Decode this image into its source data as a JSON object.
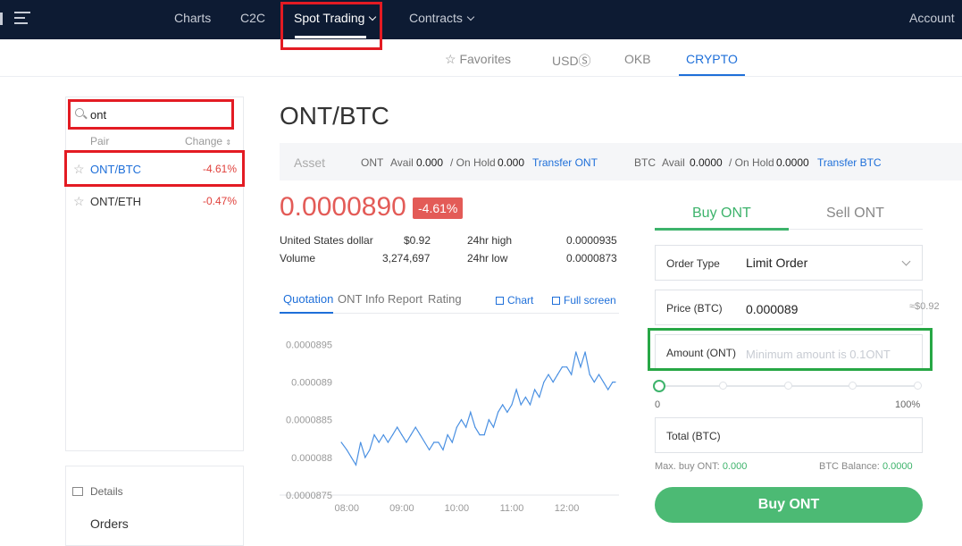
{
  "topnav": {
    "items": [
      {
        "label": "Charts"
      },
      {
        "label": "C2C"
      },
      {
        "label": "Spot Trading"
      },
      {
        "label": "Contracts"
      }
    ],
    "account": "Account"
  },
  "subnav": {
    "items": [
      {
        "label": "Favorites"
      },
      {
        "label": "USDⓈ"
      },
      {
        "label": "OKB"
      },
      {
        "label": "CRYPTO"
      }
    ]
  },
  "pairs_panel": {
    "search_value": "ont",
    "col_pair": "Pair",
    "col_change": "Change",
    "rows": [
      {
        "name": "ONT/BTC",
        "change": "-4.61%"
      },
      {
        "name": "ONT/ETH",
        "change": "-0.47%"
      }
    ],
    "details": "Details",
    "orders": "Orders"
  },
  "main": {
    "pair_title": "ONT/BTC",
    "asset_bar": {
      "label": "Asset",
      "ont": {
        "coin": "ONT",
        "avail_label": "Avail",
        "avail": "0.000",
        "hold_label": "/ On Hold",
        "hold": "0.000",
        "transfer": "Transfer ONT"
      },
      "btc": {
        "coin": "BTC",
        "avail_label": "Avail",
        "avail": "0.0000",
        "hold_label": "/ On Hold",
        "hold": "0.0000",
        "transfer": "Transfer BTC"
      }
    },
    "price": "0.0000890",
    "change_badge": "-4.61%",
    "stats": {
      "usd_label": "United States dollar",
      "usd_value": "$0.92",
      "high_label": "24hr high",
      "high_value": "0.0000935",
      "volume_label": "Volume",
      "volume_value": "3,274,697",
      "low_label": "24hr low",
      "low_value": "0.0000873"
    },
    "tabs": [
      "Quotation",
      "ONT Info",
      "Report",
      "Rating"
    ],
    "tools": {
      "chart": "Chart",
      "fullscreen": "Full screen"
    }
  },
  "chart_data": {
    "type": "line",
    "x_ticks": [
      "08:00",
      "09:00",
      "10:00",
      "11:00",
      "12:00"
    ],
    "y_ticks": [
      "0.0000895",
      "0.000089",
      "0.0000885",
      "0.000088",
      "0.0000875"
    ],
    "ylim": [
      8.75e-05,
      8.96e-05
    ],
    "series": [
      {
        "color": "#4a90e2",
        "x": [
          "07:54",
          "08:00",
          "08:05",
          "08:10",
          "08:15",
          "08:20",
          "08:25",
          "08:30",
          "08:35",
          "08:40",
          "08:45",
          "08:50",
          "08:55",
          "09:00",
          "09:05",
          "09:10",
          "09:15",
          "09:20",
          "09:25",
          "09:30",
          "09:35",
          "09:40",
          "09:45",
          "09:50",
          "09:55",
          "10:00",
          "10:05",
          "10:10",
          "10:15",
          "10:20",
          "10:25",
          "10:30",
          "10:35",
          "10:40",
          "10:45",
          "10:50",
          "10:55",
          "11:00",
          "11:05",
          "11:10",
          "11:15",
          "11:20",
          "11:25",
          "11:30",
          "11:35",
          "11:40",
          "11:45",
          "11:50",
          "11:55",
          "12:00",
          "12:05",
          "12:10",
          "12:15",
          "12:20",
          "12:25",
          "12:30",
          "12:35",
          "12:40",
          "12:45",
          "12:50",
          "12:53"
        ],
        "values": [
          8.82e-05,
          8.81e-05,
          8.8e-05,
          8.79e-05,
          8.82e-05,
          8.8e-05,
          8.81e-05,
          8.83e-05,
          8.82e-05,
          8.83e-05,
          8.82e-05,
          8.83e-05,
          8.84e-05,
          8.83e-05,
          8.82e-05,
          8.83e-05,
          8.84e-05,
          8.83e-05,
          8.82e-05,
          8.81e-05,
          8.82e-05,
          8.82e-05,
          8.81e-05,
          8.83e-05,
          8.82e-05,
          8.84e-05,
          8.85e-05,
          8.84e-05,
          8.86e-05,
          8.84e-05,
          8.83e-05,
          8.83e-05,
          8.85e-05,
          8.84e-05,
          8.86e-05,
          8.87e-05,
          8.86e-05,
          8.87e-05,
          8.89e-05,
          8.87e-05,
          8.88e-05,
          8.87e-05,
          8.89e-05,
          8.88e-05,
          8.9e-05,
          8.91e-05,
          8.9e-05,
          8.91e-05,
          8.92e-05,
          8.92e-05,
          8.91e-05,
          8.94e-05,
          8.92e-05,
          8.94e-05,
          8.91e-05,
          8.9e-05,
          8.91e-05,
          8.9e-05,
          8.89e-05,
          8.9e-05,
          8.9e-05
        ]
      }
    ]
  },
  "order_panel": {
    "buy_tab": "Buy ONT",
    "sell_tab": "Sell ONT",
    "order_type_label": "Order Type",
    "order_type_value": "Limit Order",
    "price_label": "Price (BTC)",
    "price_value": "0.000089",
    "price_approx": "≈$0.92",
    "amount_label": "Amount (ONT)",
    "amount_placeholder": "Minimum amount is 0.1ONT",
    "slider_min": "0",
    "slider_max": "100%",
    "slider_level": 0,
    "total_label": "Total (BTC)",
    "max_buy_label": "Max. buy ONT:",
    "max_buy_value": "0.000",
    "balance_label": "BTC Balance:",
    "balance_value": "0.0000",
    "buy_button": "Buy ONT"
  },
  "colors": {
    "nav_bg": "#0d1b33",
    "accent_blue": "#1e6fd9",
    "buy_green": "#4cba74",
    "price_red": "#e35b57",
    "highlight_red": "#e31b23",
    "highlight_green": "#27a745"
  }
}
